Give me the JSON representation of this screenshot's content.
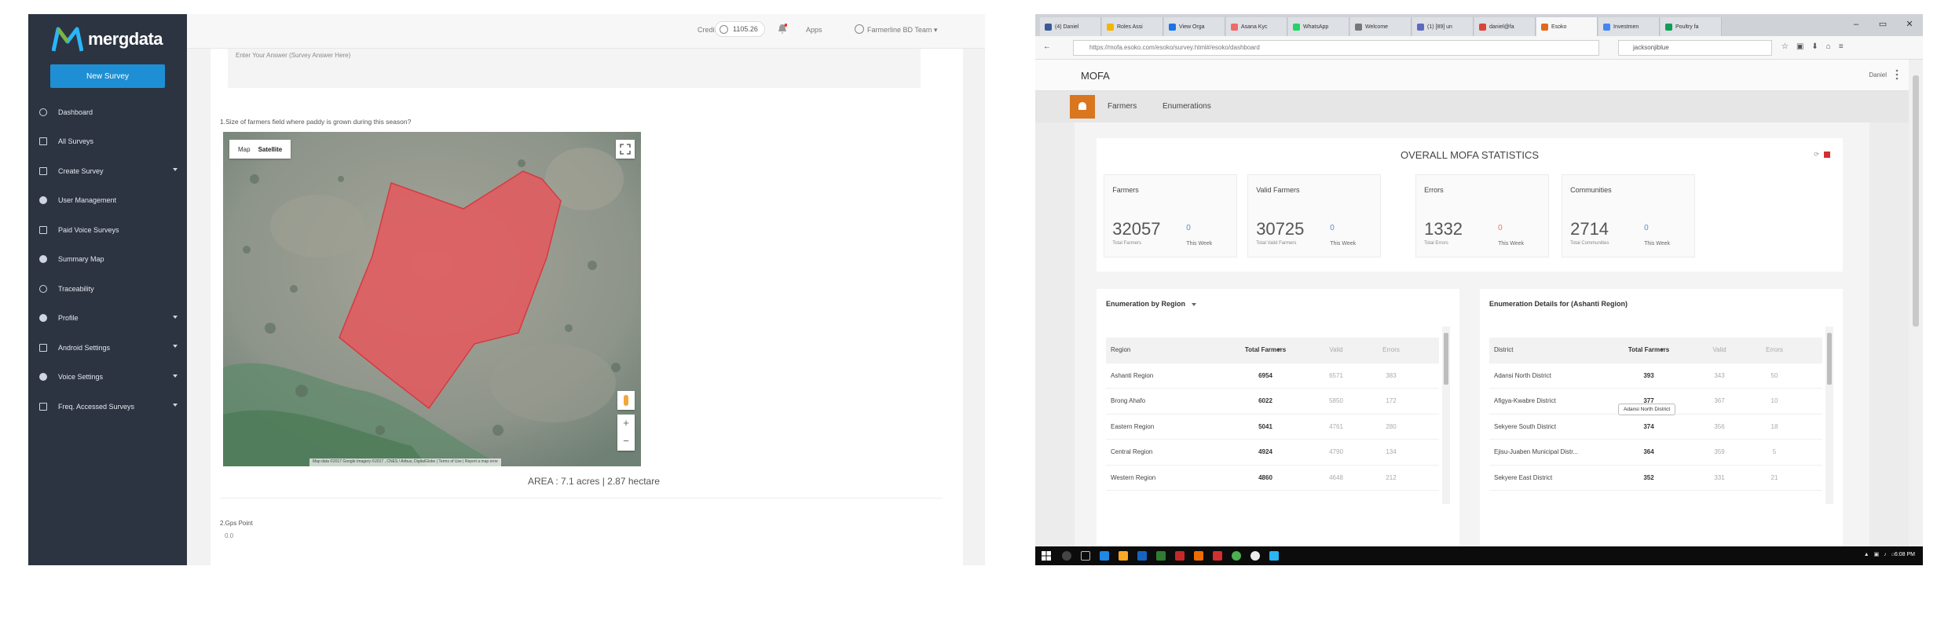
{
  "left_app": {
    "logo_text": "mergdata",
    "new_survey_label": "New Survey",
    "nav": [
      {
        "label": "Dashboard",
        "chevron": false
      },
      {
        "label": "All Surveys",
        "chevron": false
      },
      {
        "label": "Create Survey",
        "chevron": true
      },
      {
        "label": "User Management",
        "chevron": false
      },
      {
        "label": "Paid Voice Surveys",
        "chevron": false
      },
      {
        "label": "Summary Map",
        "chevron": false
      },
      {
        "label": "Traceability",
        "chevron": false
      },
      {
        "label": "Profile",
        "chevron": true
      },
      {
        "label": "Android Settings",
        "chevron": true
      },
      {
        "label": "Voice Settings",
        "chevron": true
      },
      {
        "label": "Freq. Accessed Surveys",
        "chevron": true
      }
    ],
    "topbar": {
      "credit_label": "Credit",
      "credit_value": "1105.26",
      "apps_label": "Apps",
      "user_label": "Farmerline BD Team"
    },
    "prev_answer": "Enter Your Answer (Survey Answer Here)",
    "question1": "1.Size of farmers field where paddy is grown during this season?",
    "map": {
      "type_map": "Map",
      "type_satellite": "Satellite",
      "attribution": "Map data ©2017 Google Imagery ©2017 , CNES / Airbus, DigitalGlobe  |  Terms of Use  |  Report a map error",
      "polygon_color": "#e8565c"
    },
    "area_text": "AREA : 7.1 acres | 2.87 hectare",
    "question2": "2.Gps Point",
    "question2_value": "0.0"
  },
  "right_app": {
    "browser": {
      "tabs": [
        {
          "label": "(4) Daniel",
          "color": "#3b5998"
        },
        {
          "label": "Roles Assi",
          "color": "#f5b400"
        },
        {
          "label": "View Orga",
          "color": "#1a73e8"
        },
        {
          "label": "Asana Kyc",
          "color": "#f06a6a"
        },
        {
          "label": "WhatsApp",
          "color": "#25d366"
        },
        {
          "label": "Welcome",
          "color": "#777777"
        },
        {
          "label": "(1) [89] un",
          "color": "#5c6bc0"
        },
        {
          "label": "daniel@fa",
          "color": "#db4437"
        },
        {
          "label": "Esoko",
          "color": "#e06a1b",
          "active": true
        },
        {
          "label": "Investmen",
          "color": "#4285f4"
        },
        {
          "label": "Poultry fa",
          "color": "#0f9d58"
        }
      ],
      "url": "https://mofa.esoko.com/esoko/survey.html#/esoko/dashboard",
      "search": "jacksonjiblue"
    },
    "header": {
      "title": "MOFA",
      "user": "Daniel"
    },
    "subnav": {
      "farmers": "Farmers",
      "enumerations": "Enumerations"
    },
    "stats": {
      "title": "OVERALL MOFA STATISTICS",
      "boxes": [
        {
          "label": "Farmers",
          "value": "32057",
          "sub": "Total Farmers",
          "week": "0",
          "week_label": "This Week",
          "week_color": "#4a90d9"
        },
        {
          "label": "Valid Farmers",
          "value": "30725",
          "sub": "Total Valid Farmers",
          "week": "0",
          "week_label": "This Week",
          "week_color": "#4a90d9"
        },
        {
          "label": "Errors",
          "value": "1332",
          "sub": "Total Errors",
          "week": "0",
          "week_label": "This Week",
          "week_color": "#e57373"
        },
        {
          "label": "Communities",
          "value": "2714",
          "sub": "Total Communities",
          "week": "0",
          "week_label": "This Week",
          "week_color": "#4a90d9"
        }
      ]
    },
    "region_table": {
      "title": "Enumeration by Region",
      "headers": [
        "Region",
        "Total Farmers",
        "Valid",
        "Errors"
      ],
      "rows": [
        [
          "Ashanti Region",
          "6954",
          "6571",
          "383"
        ],
        [
          "Brong Ahafo",
          "6022",
          "5850",
          "172"
        ],
        [
          "Eastern Region",
          "5041",
          "4761",
          "280"
        ],
        [
          "Central Region",
          "4924",
          "4790",
          "134"
        ],
        [
          "Western Region",
          "4860",
          "4648",
          "212"
        ]
      ]
    },
    "district_table": {
      "title": "Enumeration Details for (Ashanti Region)",
      "headers": [
        "District",
        "Total Farmers",
        "Valid",
        "Errors"
      ],
      "rows": [
        [
          "Adansi North District",
          "393",
          "343",
          "50"
        ],
        [
          "Afigya-Kwabre District",
          "377",
          "367",
          "10"
        ],
        [
          "Sekyere South District",
          "374",
          "356",
          "18"
        ],
        [
          "Ejisu-Juaben Municipal Distr...",
          "364",
          "359",
          "5"
        ],
        [
          "Sekyere East District",
          "352",
          "331",
          "21"
        ]
      ],
      "tooltip": "Adansi North District"
    },
    "taskbar": {
      "clock": "6:08 PM"
    }
  }
}
